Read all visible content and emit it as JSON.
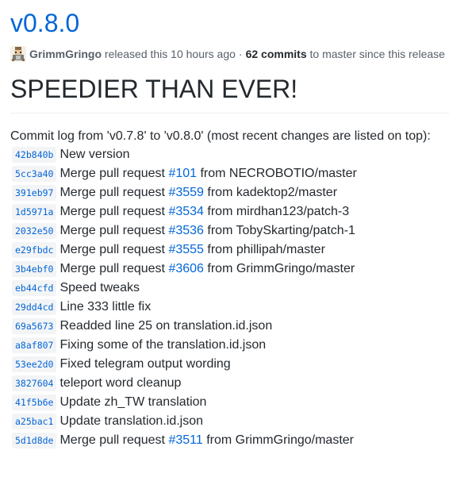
{
  "release": {
    "tag": "v0.8.0",
    "author": "GrimmGringo",
    "released_text": "released this 10 hours ago",
    "separator": "·",
    "commits_count": "62 commits",
    "commits_suffix": "to master since this release"
  },
  "body": {
    "heading": "SPEEDIER THAN EVER!",
    "intro": "Commit log from 'v0.7.8' to 'v0.8.0' (most recent changes are listed on top):"
  },
  "commits": [
    {
      "sha": "42b840b",
      "text": "New version"
    },
    {
      "sha": "5cc3a40",
      "before": "Merge pull request",
      "pr": "#101",
      "after": "from NECROBOTIO/master"
    },
    {
      "sha": "391eb97",
      "before": "Merge pull request",
      "pr": "#3559",
      "after": "from kadektop2/master"
    },
    {
      "sha": "1d5971a",
      "before": "Merge pull request",
      "pr": "#3534",
      "after": "from mirdhan123/patch-3"
    },
    {
      "sha": "2032e50",
      "before": "Merge pull request",
      "pr": "#3536",
      "after": "from TobySkarting/patch-1"
    },
    {
      "sha": "e29fbdc",
      "before": "Merge pull request",
      "pr": "#3555",
      "after": "from phillipah/master"
    },
    {
      "sha": "3b4ebf0",
      "before": "Merge pull request",
      "pr": "#3606",
      "after": "from GrimmGringo/master"
    },
    {
      "sha": "eb44cfd",
      "text": "Speed tweaks"
    },
    {
      "sha": "29dd4cd",
      "text": "Line 333 little fix"
    },
    {
      "sha": "69a5673",
      "text": "Readded line 25 on translation.id.json"
    },
    {
      "sha": "a8af807",
      "text": "Fixing some of the translation.id.json"
    },
    {
      "sha": "53ee2d0",
      "text": "Fixed telegram output wording"
    },
    {
      "sha": "3827604",
      "text": "teleport word cleanup"
    },
    {
      "sha": "41f5b6e",
      "text": "Update zh_TW translation"
    },
    {
      "sha": "a25bac1",
      "text": "Update translation.id.json"
    },
    {
      "sha": "5d1d8de",
      "before": "Merge pull request",
      "pr": "#3511",
      "after": "from GrimmGringo/master"
    }
  ],
  "icons": {
    "avatar": "pixel-avatar-icon"
  },
  "colors": {
    "link": "#0366d6",
    "text": "#24292e",
    "muted": "#586069",
    "sha_bg": "#f3f4f6",
    "divider": "#eaecef"
  }
}
